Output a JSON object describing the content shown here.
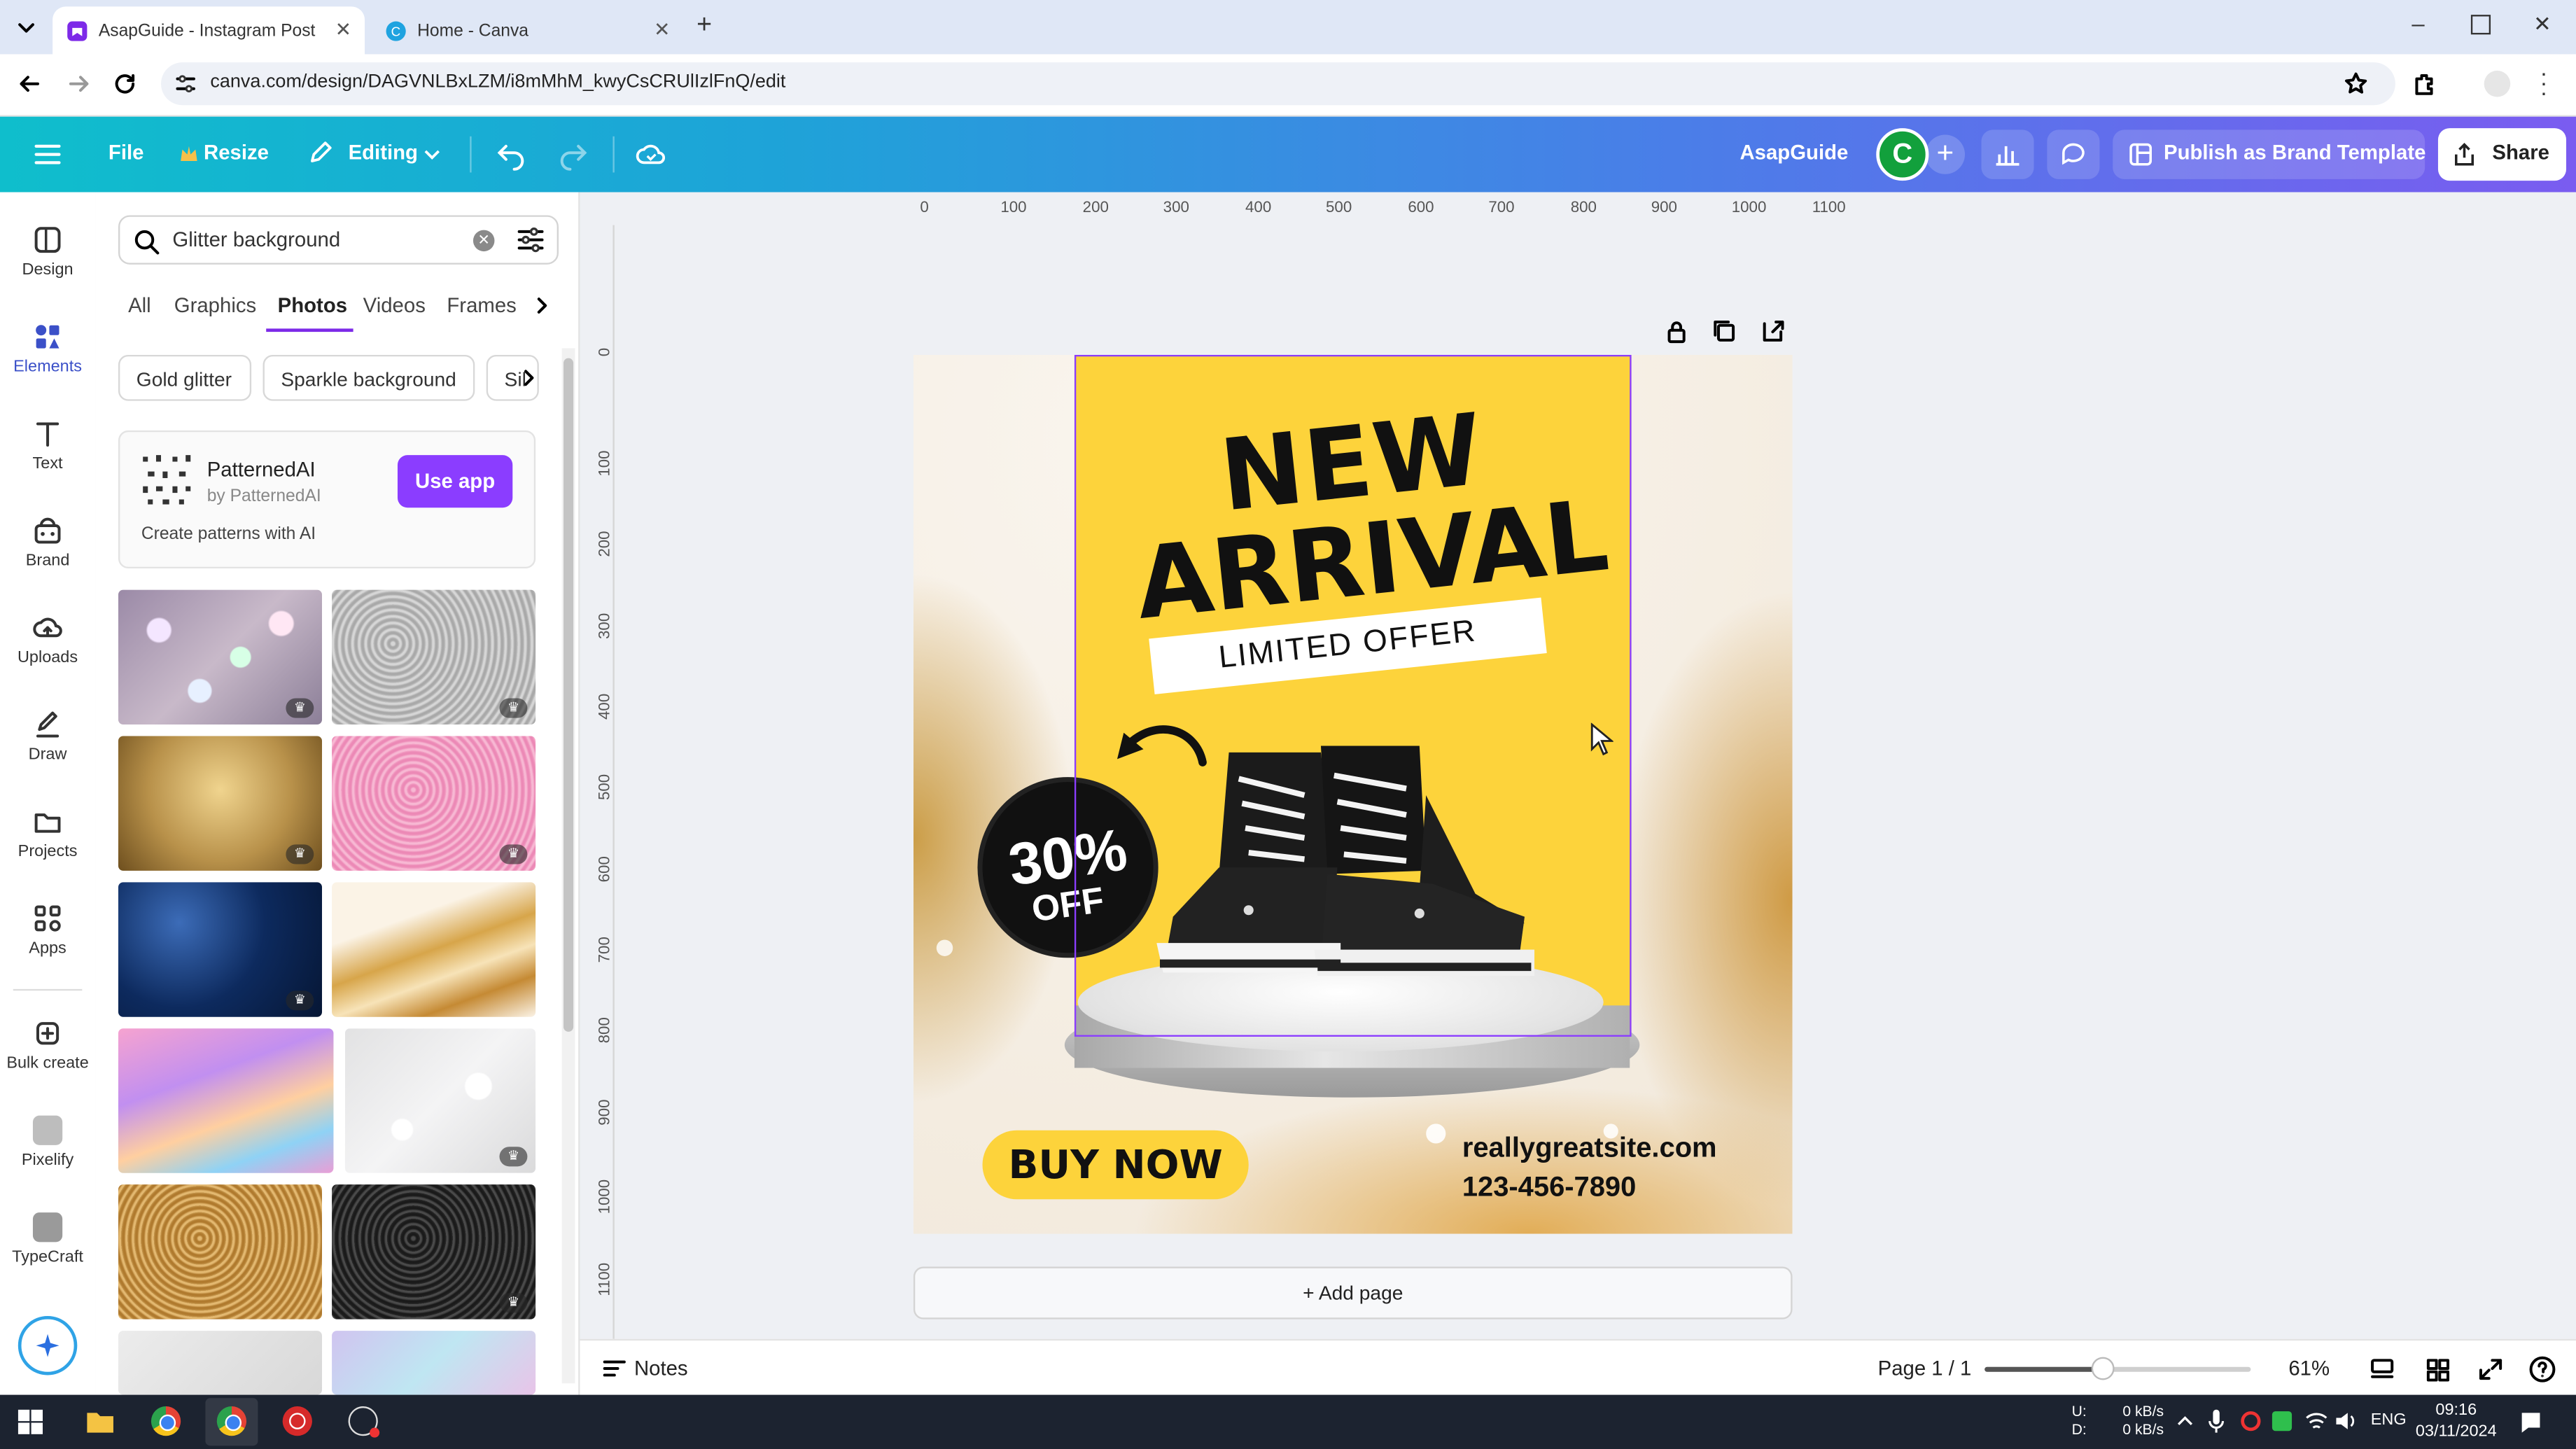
{
  "browser": {
    "tabs": [
      {
        "title": "AsapGuide - Instagram Post",
        "active": true
      },
      {
        "title": "Home - Canva",
        "active": false
      }
    ],
    "url": "canva.com/design/DAGVNLBxLZM/i8mMhM_kwyCsCRUlIzlFnQ/edit"
  },
  "toolbar": {
    "file_label": "File",
    "resize_label": "Resize",
    "editing_label": "Editing",
    "team_name": "AsapGuide",
    "avatar_letter": "C",
    "publish_label": "Publish as Brand Template",
    "share_label": "Share"
  },
  "rail": {
    "items": [
      {
        "label": "Design",
        "icon": "design-icon"
      },
      {
        "label": "Elements",
        "icon": "elements-icon"
      },
      {
        "label": "Text",
        "icon": "text-icon"
      },
      {
        "label": "Brand",
        "icon": "brand-icon"
      },
      {
        "label": "Uploads",
        "icon": "uploads-icon"
      },
      {
        "label": "Draw",
        "icon": "draw-icon"
      },
      {
        "label": "Projects",
        "icon": "projects-icon"
      },
      {
        "label": "Apps",
        "icon": "apps-icon"
      },
      {
        "label": "Bulk create",
        "icon": "bulk-create-icon"
      },
      {
        "label": "Pixelify",
        "icon": "pixelify-icon"
      },
      {
        "label": "TypeCraft",
        "icon": "typecraft-icon"
      }
    ]
  },
  "panel": {
    "search_value": "Glitter background",
    "tabs": [
      "All",
      "Graphics",
      "Photos",
      "Videos",
      "Frames"
    ],
    "active_tab": "Photos",
    "chips": [
      "Gold glitter",
      "Sparkle background",
      "Sil"
    ],
    "app_card": {
      "name": "PatternedAI",
      "by": "by PatternedAI",
      "button": "Use app",
      "description": "Create patterns with AI"
    },
    "thumb_colors": [
      "#b9a8c0",
      "#c4c4c4",
      "#b8914a",
      "#f2a6c8",
      "#0d2a5e",
      "#d8b880",
      "#e6a0d8",
      "#e9e9ea",
      "#c89a50",
      "#2a2a2a",
      "#e0e0e0",
      "#c8c0e8"
    ]
  },
  "ruler": {
    "h_ticks": [
      "0",
      "100",
      "200",
      "300",
      "400",
      "500",
      "600",
      "700",
      "800",
      "900",
      "1000",
      "1100"
    ],
    "v_ticks": [
      "0",
      "100",
      "200",
      "300",
      "400",
      "500",
      "600",
      "700",
      "800",
      "900",
      "1000",
      "1100"
    ]
  },
  "design": {
    "headline_1": "NEW",
    "headline_2": "ARRIVAL",
    "banner": "LIMITED OFFER",
    "discount_1": "30%",
    "discount_2": "OFF",
    "cta": "BUY NOW",
    "website": "reallygreatsite.com",
    "phone": "123-456-7890",
    "colors": {
      "yellow": "#fdd33b",
      "black": "#111111",
      "gold": "#c9993f",
      "selection": "#8b3dff"
    }
  },
  "canvas": {
    "add_page": "+ Add page"
  },
  "bottom": {
    "notes_label": "Notes",
    "page_label": "Page 1 / 1",
    "zoom_value": 0.61,
    "zoom_label": "61%"
  },
  "taskbar": {
    "net_up": "U:",
    "net_down": "D:",
    "net_up_rate": "0 kB/s",
    "net_down_rate": "0 kB/s",
    "lang": "ENG",
    "time": "09:16",
    "date": "03/11/2024"
  }
}
